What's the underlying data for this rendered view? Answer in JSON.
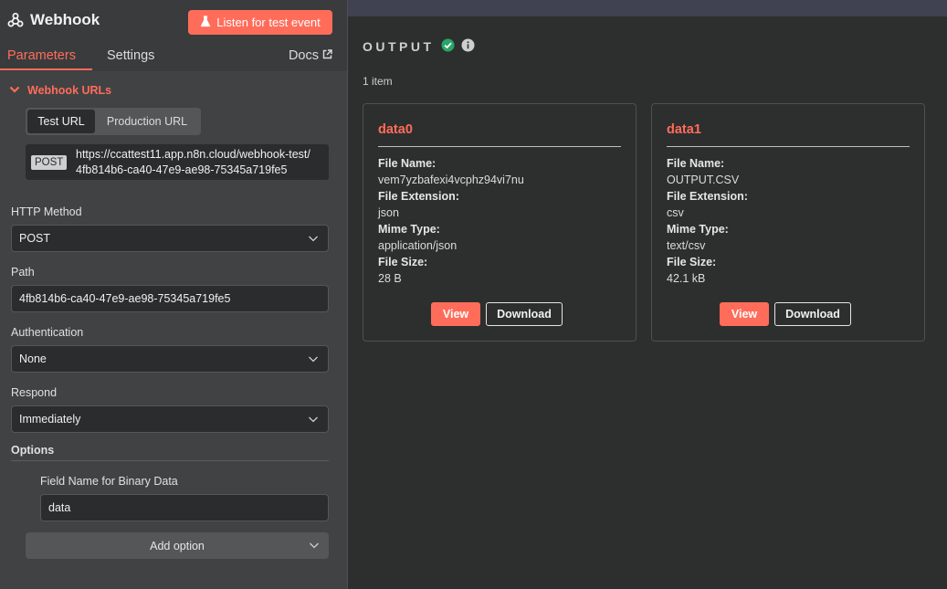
{
  "node": {
    "title": "Webhook",
    "listen_button": "Listen for test event"
  },
  "tabs": [
    {
      "label": "Parameters",
      "active": true
    },
    {
      "label": "Settings",
      "active": false
    }
  ],
  "docs_label": "Docs",
  "webhook_urls": {
    "section_label": "Webhook URLs",
    "toggle": [
      "Test URL",
      "Production URL"
    ],
    "selected": "Test URL",
    "method_badge": "POST",
    "url_line1": "https://ccattest11.app.n8n.cloud/webhook-test/",
    "url_line2": "4fb814b6-ca40-47e9-ae98-75345a719fe5"
  },
  "fields": {
    "http_method": {
      "label": "HTTP Method",
      "value": "POST"
    },
    "path": {
      "label": "Path",
      "value": "4fb814b6-ca40-47e9-ae98-75345a719fe5"
    },
    "authentication": {
      "label": "Authentication",
      "value": "None"
    },
    "respond": {
      "label": "Respond",
      "value": "Immediately"
    }
  },
  "options": {
    "label": "Options",
    "binary_field_label": "Field Name for Binary Data",
    "binary_field_value": "data",
    "add_option": "Add option"
  },
  "output": {
    "title": "OUTPUT",
    "count": "1 item",
    "status_color": "#29a568",
    "cards": [
      {
        "title": "data0",
        "file_name_label": "File Name:",
        "file_name": "vem7yzbafexi4vcphz94vi7nu",
        "ext_label": "File Extension:",
        "ext": "json",
        "mime_label": "Mime Type:",
        "mime": "application/json",
        "size_label": "File Size:",
        "size": "28 B",
        "view": "View",
        "download": "Download"
      },
      {
        "title": "data1",
        "file_name_label": "File Name:",
        "file_name": "OUTPUT.CSV",
        "ext_label": "File Extension:",
        "ext": "csv",
        "mime_label": "Mime Type:",
        "mime": "text/csv",
        "size_label": "File Size:",
        "size": "42.1 kB",
        "view": "View",
        "download": "Download"
      }
    ]
  },
  "colors": {
    "accent": "#ff6d5a",
    "panel": "#414244",
    "canvas": "#2d2e2e"
  }
}
